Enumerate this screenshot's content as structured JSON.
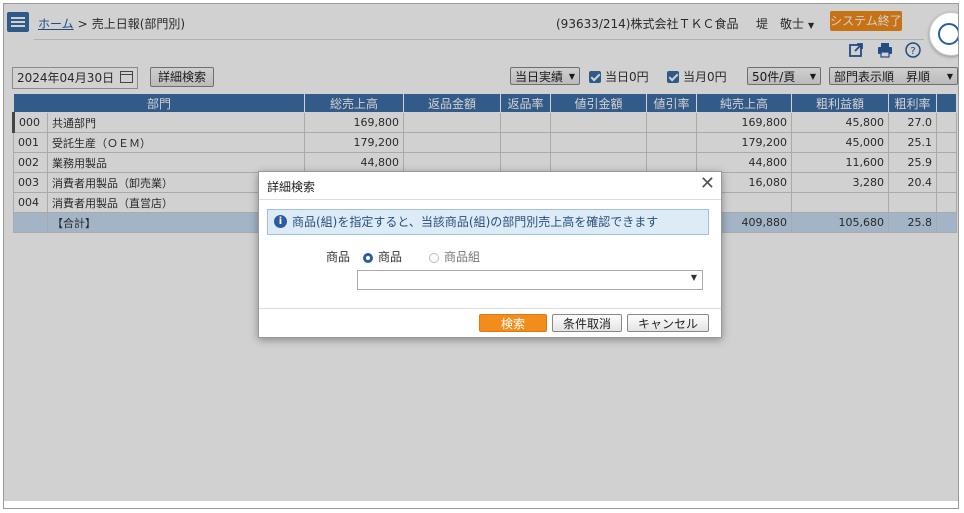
{
  "header": {
    "home_link": "ホーム",
    "separator": ">",
    "page_title": "売上日報(部門別)",
    "company": "(93633/214)株式会社ＴＫＣ食品",
    "user": "堤　敬士",
    "exit_button": "システム終了"
  },
  "toolbar": {
    "date": "2024年04月30日",
    "detail_search": "詳細検索",
    "mode_select": "当日実績",
    "today_zero": "当日0円",
    "month_zero": "当月0円",
    "page_size": "50件/頁",
    "sort_select": "部門表示順　昇順"
  },
  "table": {
    "columns": [
      "部門",
      "総売上高",
      "返品金額",
      "返品率",
      "値引金額",
      "値引率",
      "純売上高",
      "粗利益額",
      "粗利率"
    ],
    "rows": [
      {
        "code": "000",
        "name": "共通部門",
        "gross": "169,800",
        "ret": "",
        "ret_rate": "",
        "disc": "",
        "disc_rate": "",
        "net": "169,800",
        "profit": "45,800",
        "profit_rate": "27.0"
      },
      {
        "code": "001",
        "name": "受託生産（ＯＥＭ）",
        "gross": "179,200",
        "ret": "",
        "ret_rate": "",
        "disc": "",
        "disc_rate": "",
        "net": "179,200",
        "profit": "45,000",
        "profit_rate": "25.1"
      },
      {
        "code": "002",
        "name": "業務用製品",
        "gross": "44,800",
        "ret": "",
        "ret_rate": "",
        "disc": "",
        "disc_rate": "",
        "net": "44,800",
        "profit": "11,600",
        "profit_rate": "25.9"
      },
      {
        "code": "003",
        "name": "消費者用製品（卸売業）",
        "gross": "",
        "ret": "",
        "ret_rate": "",
        "disc": "",
        "disc_rate": "",
        "net": "16,080",
        "profit": "3,280",
        "profit_rate": "20.4"
      },
      {
        "code": "004",
        "name": "消費者用製品（直営店）",
        "gross": "",
        "ret": "",
        "ret_rate": "",
        "disc": "",
        "disc_rate": "",
        "net": "",
        "profit": "",
        "profit_rate": ""
      }
    ],
    "total": {
      "label": "【合計】",
      "net": "409,880",
      "profit": "105,680",
      "profit_rate": "25.8"
    }
  },
  "dialog": {
    "title": "詳細検索",
    "close": "✕",
    "info": "商品(組)を指定すると、当該商品(組)の部門別売上高を確認できます",
    "label": "商品",
    "radio_product": "商品",
    "radio_group": "商品組",
    "combo_value": "",
    "search_button": "検索",
    "clear_button": "条件取消",
    "cancel_button": "キャンセル"
  },
  "icons": [
    "external-link-icon",
    "print-icon",
    "help-icon"
  ],
  "colors": {
    "accent": "#3f6fa8",
    "orange": "#f28c1a",
    "total_row": "#c7dcf2"
  }
}
